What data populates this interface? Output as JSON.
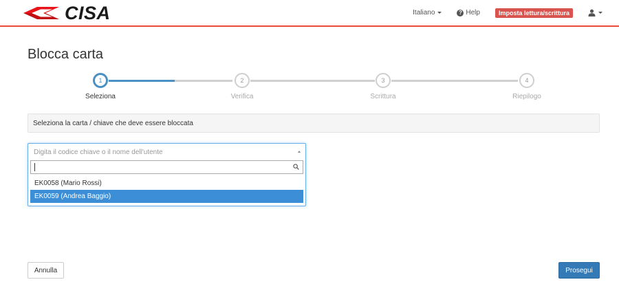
{
  "brand": {
    "logo_text": "CISA",
    "logo_color": "#e8141a"
  },
  "nav": {
    "language": "Italiano",
    "help": "Help",
    "rw_badge": "Imposta lettura/scrittura"
  },
  "page": {
    "title": "Blocca carta"
  },
  "stepper": {
    "steps": [
      {
        "number": "1",
        "label": "Seleziona"
      },
      {
        "number": "2",
        "label": "Verifica"
      },
      {
        "number": "3",
        "label": "Scrittura"
      },
      {
        "number": "4",
        "label": "Riepilogo"
      }
    ],
    "active_index": 0
  },
  "info": {
    "text": "Seleziona la carta / chiave che deve essere bloccata"
  },
  "select": {
    "placeholder": "Digita il codice chiave o il nome dell'utente",
    "search_value": "",
    "options": [
      {
        "label": "EK0058 (Mario Rossi)"
      },
      {
        "label": "EK0059 (Andrea Baggio)"
      }
    ],
    "highlighted_index": 1
  },
  "actions": {
    "cancel": "Annulla",
    "next": "Prosegui"
  },
  "colors": {
    "accent": "#337ab7",
    "step_active": "#4a90c2",
    "navbar_border": "#e74c3c",
    "badge": "#d9534f"
  }
}
